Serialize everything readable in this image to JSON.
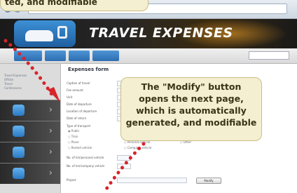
{
  "top_callout": {
    "text": "ted, and modifiable"
  },
  "browser": {
    "url": "http://localhost/...../travelexpenses/form/..."
  },
  "app": {
    "title": "TRAVEL EXPENSES"
  },
  "nav": {
    "tabs": [
      "",
      "",
      "",
      ""
    ]
  },
  "sidebar": {
    "link_lines": [
      "Travel Expenses",
      "Offsite",
      "Travel",
      "Conferences"
    ]
  },
  "form": {
    "title": "Expenses form",
    "labels": [
      "Caption of travel",
      "Fee amount",
      "Unit",
      "Date of departure",
      "Location of departure",
      "Date of return",
      "Type of transport",
      "No. of km/personal vehicle",
      "No. of km/company vehicle",
      "Project"
    ],
    "options": [
      "Public",
      "Train",
      "Plane",
      "Rented vehicle",
      "Personal vehicle",
      "Company vehicle",
      "Other"
    ],
    "modify_button": "Modify"
  },
  "callout": {
    "lines": [
      "The \"Modify\" button",
      "opens the next page,",
      "which is automatically",
      "generated, and modifiable"
    ]
  },
  "colors": {
    "callout_bg": "#f4efd0",
    "arrow": "#d8232a",
    "accent": "#2c6db0"
  }
}
